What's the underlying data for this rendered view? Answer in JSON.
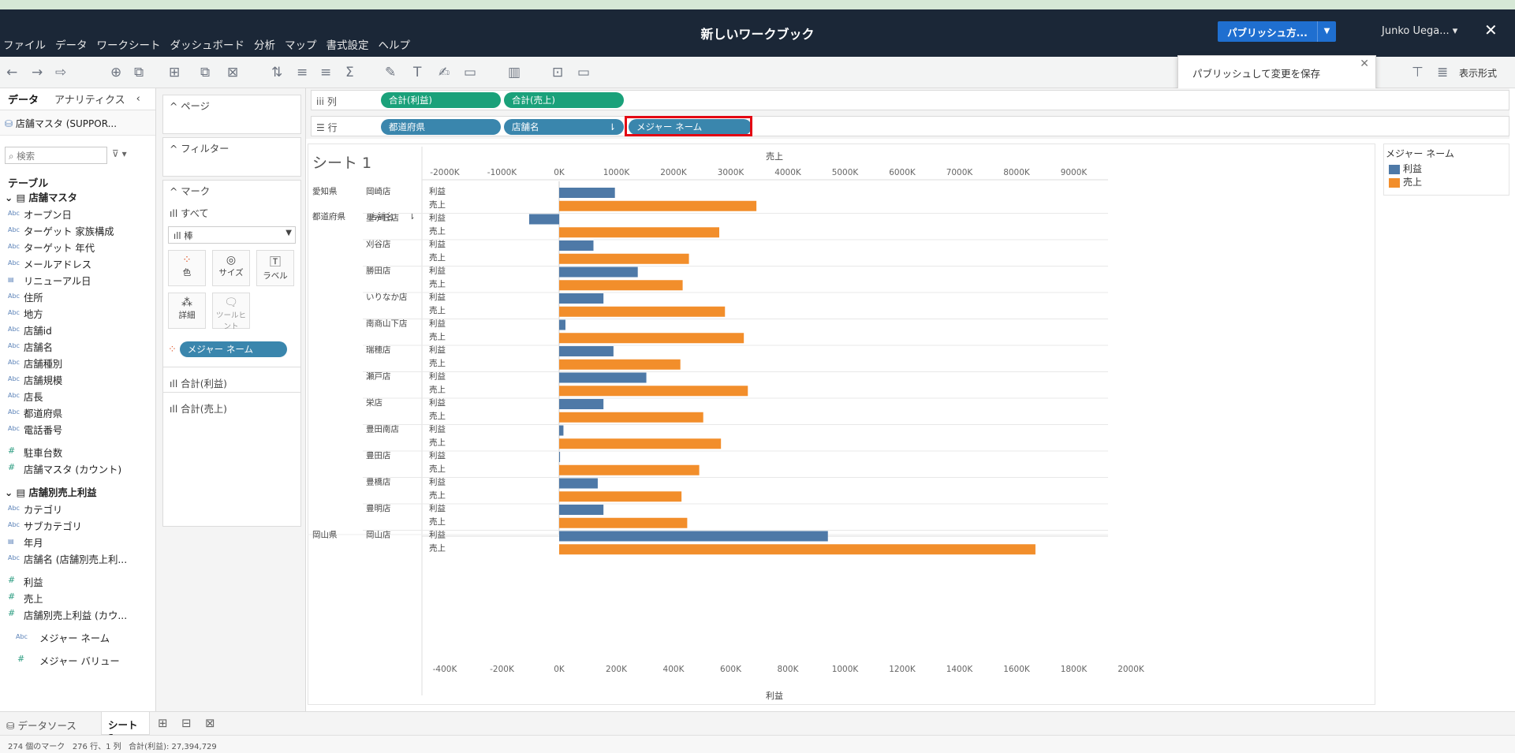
{
  "window": {
    "title": "新しいワークブック",
    "user": "Junko Uega...",
    "publish_label": "パブリッシュ方...",
    "close": "✕"
  },
  "menu": [
    "ファイル",
    "データ",
    "ワークシート",
    "ダッシュボード",
    "分析",
    "マップ",
    "書式設定",
    "ヘルプ"
  ],
  "toolbar": {
    "publish_tip": "パブリッシュして変更を保存",
    "present_label": "表示形式"
  },
  "data_pane": {
    "tab_data": "データ",
    "tab_analytics": "アナリティクス",
    "datasource": "店舗マスタ (SUPPOR...",
    "search_placeholder": "検索",
    "tables_heading": "テーブル",
    "group1": "店舗マスタ",
    "group1_fields": [
      {
        "t": "Abc",
        "n": "オープン日"
      },
      {
        "t": "Abc",
        "n": "ターゲット 家族構成"
      },
      {
        "t": "Abc",
        "n": "ターゲット 年代"
      },
      {
        "t": "Abc",
        "n": "メールアドレス"
      },
      {
        "t": "▤",
        "n": "リニューアル日"
      },
      {
        "t": "Abc",
        "n": "住所"
      },
      {
        "t": "Abc",
        "n": "地方"
      },
      {
        "t": "Abc",
        "n": "店舗id"
      },
      {
        "t": "Abc",
        "n": "店舗名"
      },
      {
        "t": "Abc",
        "n": "店舗種別"
      },
      {
        "t": "Abc",
        "n": "店舗規模"
      },
      {
        "t": "Abc",
        "n": "店長"
      },
      {
        "t": "Abc",
        "n": "都道府県"
      },
      {
        "t": "Abc",
        "n": "電話番号"
      }
    ],
    "group1_measures": [
      "駐車台数",
      "店舗マスタ (カウント)"
    ],
    "group2": "店舗別売上利益",
    "group2_fields": [
      {
        "t": "Abc",
        "n": "カテゴリ"
      },
      {
        "t": "Abc",
        "n": "サブカテゴリ"
      },
      {
        "t": "▤",
        "n": "年月"
      },
      {
        "t": "Abc",
        "n": "店舗名 (店舗別売上利..."
      }
    ],
    "group2_measures": [
      "利益",
      "売上",
      "店舗別売上利益 (カウ..."
    ],
    "measure_names": "メジャー ネーム",
    "measure_values": "メジャー バリュー"
  },
  "cards": {
    "pages": "ページ",
    "filters": "フィルター",
    "marks": "マーク",
    "marks_all": "すべて",
    "mark_type": "棒",
    "btn_color": "色",
    "btn_size": "サイズ",
    "btn_label": "ラベル",
    "btn_detail": "詳細",
    "btn_tooltip": "ツールヒント",
    "color_pill": "メジャー ネーム",
    "mark_sum_profit": "合計(利益)",
    "mark_sum_sales": "合計(売上)"
  },
  "shelves": {
    "columns_label": "列",
    "rows_label": "行",
    "columns": [
      "合計(利益)",
      "合計(売上)"
    ],
    "rows": [
      "都道府県",
      "店舗名",
      "メジャー ネーム"
    ]
  },
  "sheet": {
    "title": "シート 1"
  },
  "legend": {
    "title": "メジャー ネーム",
    "items": [
      {
        "name": "利益",
        "color": "#4e79a7"
      },
      {
        "name": "売上",
        "color": "#f28e2b"
      }
    ]
  },
  "chart_data": {
    "type": "bar",
    "top_axis_title": "売上",
    "bottom_axis_title": "利益",
    "row_headers": [
      "都道府県",
      "店舗名"
    ],
    "sales_ticks": [
      "-2000K",
      "-1000K",
      "0K",
      "1000K",
      "2000K",
      "3000K",
      "4000K",
      "5000K",
      "6000K",
      "7000K",
      "8000K",
      "9000K"
    ],
    "profit_ticks": [
      "-400K",
      "-200K",
      "0K",
      "200K",
      "400K",
      "600K",
      "800K",
      "1000K",
      "1200K",
      "1400K",
      "1600K",
      "1800K",
      "2000K"
    ],
    "sales_range": [
      -2400,
      9700
    ],
    "profit_range": [
      -480,
      2020
    ],
    "measure_labels": [
      "利益",
      "売上"
    ],
    "stores": [
      {
        "pref": "愛知県",
        "name": "岡崎店",
        "profit": 195,
        "sales": 3450
      },
      {
        "pref": "",
        "name": "星ヶ丘店",
        "profit": -105,
        "sales": 2800
      },
      {
        "pref": "",
        "name": "刈谷店",
        "profit": 120,
        "sales": 2270
      },
      {
        "pref": "",
        "name": "勝田店",
        "profit": 275,
        "sales": 2160
      },
      {
        "pref": "",
        "name": "いりなか店",
        "profit": 155,
        "sales": 2900
      },
      {
        "pref": "",
        "name": "南商山下店",
        "profit": 22,
        "sales": 3230
      },
      {
        "pref": "",
        "name": "瑞穂店",
        "profit": 190,
        "sales": 2120
      },
      {
        "pref": "",
        "name": "瀬戸店",
        "profit": 305,
        "sales": 3300
      },
      {
        "pref": "",
        "name": "栄店",
        "profit": 155,
        "sales": 2520
      },
      {
        "pref": "",
        "name": "豊田南店",
        "profit": 15,
        "sales": 2830
      },
      {
        "pref": "",
        "name": "豊田店",
        "profit": 3,
        "sales": 2450
      },
      {
        "pref": "",
        "name": "豊橋店",
        "profit": 135,
        "sales": 2140
      },
      {
        "pref": "",
        "name": "豊明店",
        "profit": 155,
        "sales": 2240
      },
      {
        "pref": "岡山県",
        "name": "岡山店",
        "profit": 940,
        "sales": 8330
      }
    ]
  },
  "tabs": {
    "datasource": "データソース",
    "sheet1": "シート 1"
  },
  "status": {
    "marks": "274 個のマーク",
    "rows_cols": "276 行、1 列",
    "sum": "合計(利益): 27,394,729"
  }
}
